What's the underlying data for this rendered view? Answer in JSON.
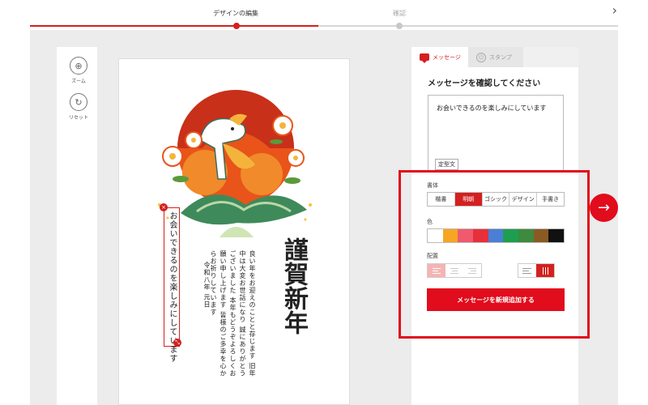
{
  "stepper": {
    "steps": [
      {
        "label": "デザインの編集",
        "active": true
      },
      {
        "label": "確認",
        "active": false
      }
    ]
  },
  "left_tools": [
    {
      "label": "ズーム",
      "icon": "zoom-icon"
    },
    {
      "label": "リセット",
      "icon": "reset-icon"
    }
  ],
  "card": {
    "greeting": "謹賀新年",
    "body_lines": [
      "良い年をお迎えのことと存じます",
      "旧年中は大変お世話になり",
      "誠にありがとうございました",
      "本年もどうぞよろしくお願い申し上げます",
      "皆様のご多幸を心からお祈りしています"
    ],
    "date_lines": [
      "令和八年",
      "元日"
    ],
    "added_message": "お会いできるのを楽しみにしています"
  },
  "panel": {
    "tabs": [
      {
        "label": "メッセージ",
        "icon": "chat-icon",
        "active": true
      },
      {
        "label": "スタンプ",
        "icon": "smile-icon",
        "active": false
      }
    ],
    "heading": "メッセージを確認してください",
    "message_value": "お会いできるのを楽しみにしています",
    "template_button": "定型文",
    "font_label": "書体",
    "fonts": [
      {
        "label": "楷書",
        "active": false
      },
      {
        "label": "明朝",
        "active": true
      },
      {
        "label": "ゴシック",
        "active": false
      },
      {
        "label": "デザイン",
        "active": false
      },
      {
        "label": "手書き",
        "active": false
      }
    ],
    "color_label": "色",
    "colors": [
      "#ffffff",
      "#f6a623",
      "#f05a6e",
      "#e8303a",
      "#4a7fd6",
      "#1e9e50",
      "#3e8a3e",
      "#8a5a24",
      "#111111"
    ],
    "layout_label": "配置",
    "add_button": "メッセージを新規追加する"
  }
}
